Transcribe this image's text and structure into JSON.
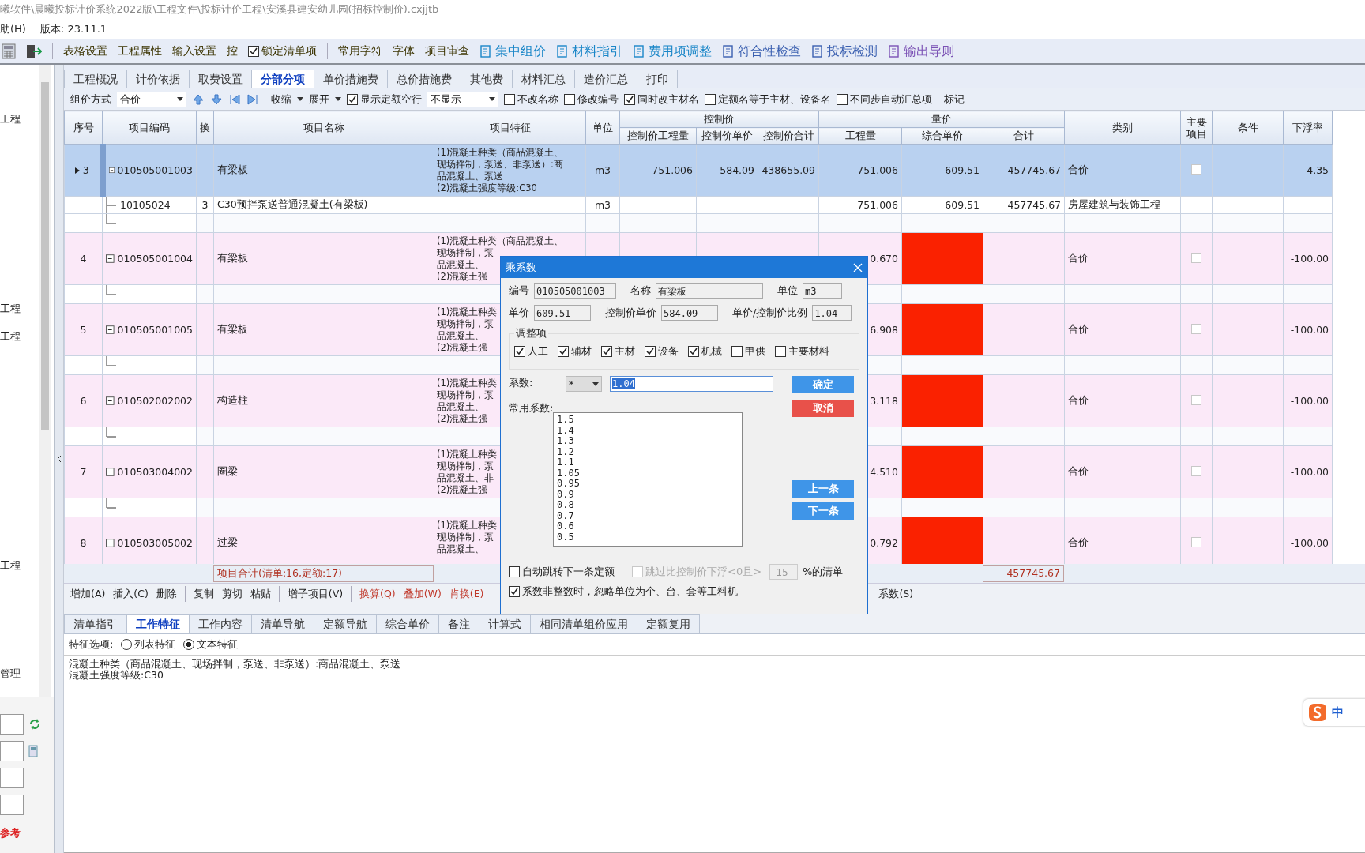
{
  "window": {
    "title": "曦软件\\晨曦投标计价系统2022版\\工程文件\\投标计价工程\\安溪县建安幼儿园(招标控制价).cxjjtb"
  },
  "menu_bar": {
    "items": [
      "助(H)"
    ],
    "version": "版本: 23.11.1"
  },
  "toolbar": {
    "items": [
      {
        "kind": "text",
        "label": "表格设置"
      },
      {
        "kind": "text",
        "label": "工程属性"
      },
      {
        "kind": "text",
        "label": "输入设置"
      },
      {
        "kind": "text",
        "label": "控"
      },
      {
        "kind": "check",
        "label": "锁定清单项",
        "checked": true
      },
      {
        "kind": "separator"
      },
      {
        "kind": "text",
        "label": "常用字符"
      },
      {
        "kind": "text",
        "label": "字体"
      },
      {
        "kind": "text",
        "label": "项目审查"
      },
      {
        "kind": "link",
        "label": "集中组价",
        "color": "#1a86c8"
      },
      {
        "kind": "link",
        "label": "材料指引",
        "color": "#1a86c8"
      },
      {
        "kind": "link",
        "label": "费用项调整",
        "color": "#1a86c8"
      },
      {
        "kind": "link",
        "label": "符合性检查",
        "color": "#3a5fb0"
      },
      {
        "kind": "link",
        "label": "投标检测",
        "color": "#3a5fb0"
      },
      {
        "kind": "link",
        "label": "输出导则",
        "color": "#7b52b5"
      }
    ]
  },
  "sidebar": {
    "items": [
      {
        "label": "工程"
      },
      {
        "label": "工程"
      },
      {
        "label": "工程"
      },
      {
        "label": "工程"
      },
      {
        "label": "管理"
      }
    ],
    "footer_label": "参考"
  },
  "tabs": [
    {
      "label": "工程概况",
      "selected": false
    },
    {
      "label": "计价依据",
      "selected": false
    },
    {
      "label": "取费设置",
      "selected": false
    },
    {
      "label": "分部分项",
      "selected": true
    },
    {
      "label": "单价措施费",
      "selected": false
    },
    {
      "label": "总价措施费",
      "selected": false
    },
    {
      "label": "其他费",
      "selected": false
    },
    {
      "label": "材料汇总",
      "selected": false
    },
    {
      "label": "造价汇总",
      "selected": false
    },
    {
      "label": "打印",
      "selected": false
    }
  ],
  "sub_toolbar": {
    "pricing_label": "组价方式",
    "pricing_value": "合价",
    "collapse": "收缩",
    "expand": "展开",
    "show_empty": {
      "label": "显示定额空行",
      "checked": true
    },
    "display_value": "不显示",
    "options": [
      {
        "label": "不改名称",
        "checked": false
      },
      {
        "label": "修改编号",
        "checked": false
      },
      {
        "label": "同时改主材名",
        "checked": true
      },
      {
        "label": "定额名等于主材、设备名",
        "checked": false
      },
      {
        "label": "不同步自动汇总项",
        "checked": false
      }
    ],
    "mark": "标记"
  },
  "table": {
    "columns": [
      {
        "label": "序号"
      },
      {
        "label": "项目编码"
      },
      {
        "label": "换"
      },
      {
        "label": "项目名称"
      },
      {
        "label": "项目特征"
      },
      {
        "label": "单位"
      },
      {
        "label": "控制价",
        "children": [
          "控制价工程量",
          "控制价单价",
          "控制价合计"
        ]
      },
      {
        "label": "量价",
        "children": [
          "工程量",
          "综合单价",
          "合计"
        ]
      },
      {
        "label": "类别"
      },
      {
        "label": "主要项目"
      },
      {
        "label": "条件"
      },
      {
        "label": "下浮率"
      }
    ],
    "rows": [
      {
        "no": "3",
        "code": "010505001003",
        "name": "有梁板",
        "features": [
          "(1)混凝土种类（商品混凝土、",
          "现场拌制，泵送、非泵送）:商",
          "品混凝土、泵送",
          "(2)混凝土强度等级:C30"
        ],
        "unit": "m3",
        "ctrl_qty": "751.006",
        "ctrl_price": "584.09",
        "ctrl_total": "438655.09",
        "qty": "751.006",
        "unit_price": "609.51",
        "total": "457745.67",
        "category": "合价",
        "main_item": false,
        "rate": "4.35",
        "selected": true,
        "warning": false,
        "expanded": true,
        "children": [
          {
            "code": "10105024",
            "swap": "3",
            "name": "C30预拌泵送普通混凝土(有梁板)",
            "unit": "m3",
            "qty": "751.006",
            "unit_price": "609.51",
            "total": "457745.67",
            "category": "房屋建筑与装饰工程"
          }
        ]
      },
      {
        "no": "4",
        "code": "010505001004",
        "name": "有梁板",
        "features": [
          "(1)混凝土种类（商品混凝土、",
          "现场拌制，泵",
          "品混凝土、",
          "(2)混凝土强"
        ],
        "qty": "0.670",
        "category": "合价",
        "main_item": false,
        "rate": "-100.00",
        "selected": false,
        "warning": true,
        "expanded": true
      },
      {
        "no": "5",
        "code": "010505001005",
        "name": "有梁板",
        "features": [
          "(1)混凝土种类",
          "现场拌制，泵",
          "品混凝土、",
          "(2)混凝土强"
        ],
        "qty": "6.908",
        "category": "合价",
        "main_item": false,
        "rate": "-100.00",
        "selected": false,
        "warning": true,
        "expanded": true
      },
      {
        "no": "6",
        "code": "010502002002",
        "name": "构造柱",
        "features": [
          "(1)混凝土种类",
          "现场拌制，泵",
          "品混凝土、",
          "(2)混凝土强"
        ],
        "qty": "3.118",
        "category": "合价",
        "main_item": false,
        "rate": "-100.00",
        "selected": false,
        "warning": true,
        "expanded": true
      },
      {
        "no": "7",
        "code": "010503004002",
        "name": "圈梁",
        "features": [
          "(1)混凝土种类",
          "现场拌制，泵",
          "品混凝土、非",
          "(2)混凝土强"
        ],
        "qty": "4.510",
        "category": "合价",
        "main_item": false,
        "rate": "-100.00",
        "selected": false,
        "warning": true,
        "expanded": true
      },
      {
        "no": "8",
        "code": "010503005002",
        "name": "过梁",
        "features": [
          "(1)混凝土种类",
          "现场拌制，泵",
          "品混凝土、"
        ],
        "qty": "0.792",
        "category": "合价",
        "main_item": false,
        "rate": "-100.00",
        "selected": false,
        "warning": true,
        "expanded": true
      }
    ],
    "summary": "项目合计(清单:16,定额:17)",
    "summary_total": "457745.67"
  },
  "action_bar": {
    "items": [
      {
        "kind": "command",
        "label": "增加(A)"
      },
      {
        "kind": "command",
        "label": "插入(C)"
      },
      {
        "kind": "command",
        "label": "删除"
      },
      {
        "kind": "separator"
      },
      {
        "kind": "command",
        "label": "复制"
      },
      {
        "kind": "command",
        "label": "剪切"
      },
      {
        "kind": "command",
        "label": "粘贴"
      },
      {
        "kind": "separator"
      },
      {
        "kind": "command",
        "label": "增子项目(V)"
      },
      {
        "kind": "separator"
      },
      {
        "kind": "alert",
        "label": "换算(Q)"
      },
      {
        "kind": "alert",
        "label": "叠加(W)"
      },
      {
        "kind": "alert",
        "label": "肯换(E)"
      },
      {
        "kind": "command",
        "label": "系数(S)"
      }
    ]
  },
  "bottom_tabs": [
    {
      "label": "清单指引",
      "selected": false
    },
    {
      "label": "工作特征",
      "selected": true
    },
    {
      "label": "工作内容",
      "selected": false
    },
    {
      "label": "清单导航",
      "selected": false
    },
    {
      "label": "定额导航",
      "selected": false
    },
    {
      "label": "综合单价",
      "selected": false
    },
    {
      "label": "备注",
      "selected": false
    },
    {
      "label": "计算式",
      "selected": false
    },
    {
      "label": "相同清单组价应用",
      "selected": false
    },
    {
      "label": "定额复用",
      "selected": false
    }
  ],
  "feature_options": {
    "label": "特征选项:",
    "choices": [
      {
        "label": "列表特征",
        "selected": false
      },
      {
        "label": "文本特征",
        "selected": true
      }
    ]
  },
  "feature_text": [
    "混凝土种类（商品混凝土、现场拌制，泵送、非泵送）:商品混凝土、泵送",
    "混凝土强度等级:C30"
  ],
  "ime": {
    "label": "中"
  },
  "dialog": {
    "title": "乘系数",
    "fields": [
      {
        "label": "编号",
        "value": "010505001003"
      },
      {
        "label": "名称",
        "value": "有梁板"
      },
      {
        "label": "单位",
        "value": "m3"
      },
      {
        "label": "单价",
        "value": "609.51"
      },
      {
        "label": "控制价单价",
        "value": "584.09"
      },
      {
        "label": "单价/控制价比例",
        "value": "1.04"
      }
    ],
    "adjust_title": "调整项",
    "adjust_items": [
      {
        "label": "人工",
        "checked": true
      },
      {
        "label": "辅材",
        "checked": true
      },
      {
        "label": "主材",
        "checked": true
      },
      {
        "label": "设备",
        "checked": true
      },
      {
        "label": "机械",
        "checked": true
      },
      {
        "label": "甲供",
        "checked": false
      },
      {
        "label": "主要材料",
        "checked": false
      }
    ],
    "factor_label": "系数:",
    "operator": "*",
    "factor": "1.04",
    "common_label": "常用系数:",
    "common": [
      "1.5",
      "1.4",
      "1.3",
      "1.2",
      "1.1",
      "1.05",
      "0.95",
      "0.9",
      "0.8",
      "0.7",
      "0.6",
      "0.5"
    ],
    "buttons": [
      {
        "label": "确定",
        "kind": "primary"
      },
      {
        "label": "取消",
        "kind": "danger"
      },
      {
        "label": "上一条",
        "kind": "primary"
      },
      {
        "label": "下一条",
        "kind": "primary"
      }
    ],
    "auto_jump": {
      "label": "自动跳转下一条定额",
      "checked": false
    },
    "skip": {
      "label": "跳过比控制价下浮<0且>",
      "checked": false,
      "disabled": true,
      "value": "-15",
      "suffix": "%的清单"
    },
    "ignore": {
      "label": "系数非整数时，忽略单位为个、台、套等工料机",
      "checked": true
    }
  }
}
